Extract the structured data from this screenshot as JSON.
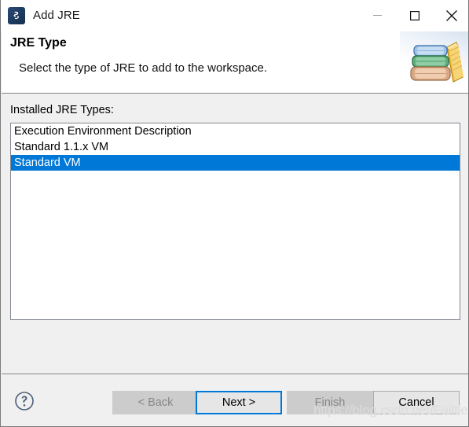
{
  "window": {
    "title": "Add JRE",
    "icon": "eclipse-jre-icon",
    "controls": [
      {
        "name": "minimize-button",
        "glyph": "minimize-icon",
        "label": "Minimize"
      },
      {
        "name": "maximize-button",
        "glyph": "maximize-icon",
        "label": "Maximize"
      },
      {
        "name": "close-button",
        "glyph": "close-icon",
        "label": "Close"
      }
    ]
  },
  "header": {
    "title": "JRE Type",
    "subtitle": "Select the type of JRE to add to the workspace.",
    "image": "stack-of-books-icon"
  },
  "main": {
    "list_label": "Installed JRE Types:",
    "items": [
      {
        "label": "Execution Environment Description",
        "selected": false
      },
      {
        "label": "Standard 1.1.x VM",
        "selected": false
      },
      {
        "label": "Standard VM",
        "selected": true
      }
    ]
  },
  "footer": {
    "help_icon": "help-circle-icon",
    "buttons": [
      {
        "label": "< Back",
        "state": "disabled"
      },
      {
        "label": "Next >",
        "state": "focused"
      },
      {
        "label": "Finish",
        "state": "disabled"
      },
      {
        "label": "Cancel",
        "state": "normal"
      }
    ]
  },
  "watermark": {
    "text": "https://blog.csdn.net/Failtle"
  },
  "colors": {
    "accent": "#0078d7",
    "dialog_bg": "#f0f0f0",
    "header_bg": "#ffffff",
    "list_bg": "#ffffff",
    "border": "#828790",
    "disabled_text": "#878787"
  }
}
